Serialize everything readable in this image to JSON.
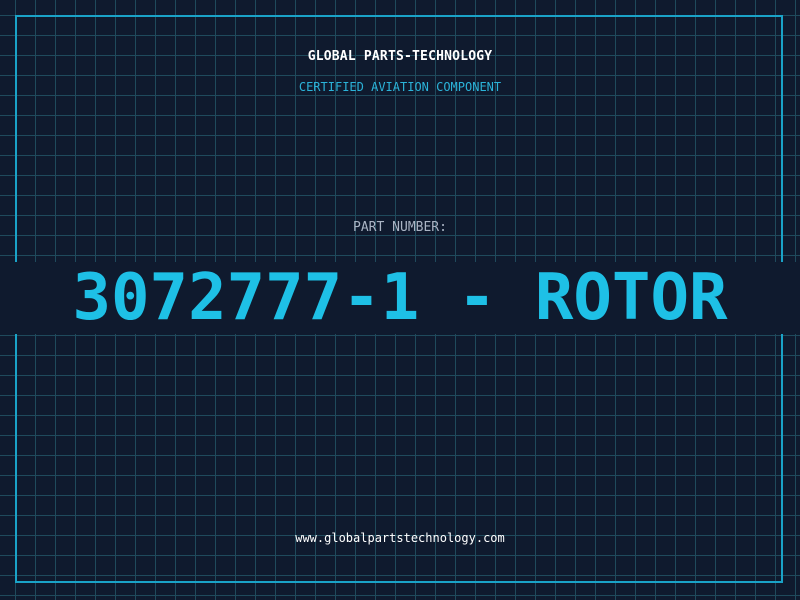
{
  "header": {
    "company": "GLOBAL PARTS-TECHNOLOGY",
    "tagline": "CERTIFIED AVIATION COMPONENT"
  },
  "part": {
    "label": "PART NUMBER:",
    "value": "3072777-1 - ROTOR"
  },
  "footer": {
    "website": "www.globalpartstechnology.com"
  },
  "colors": {
    "background": "#0f1a2e",
    "grid": "#1f4a5c",
    "accent": "#1ec0e6",
    "label": "#aab4c4",
    "text": "#ffffff"
  }
}
